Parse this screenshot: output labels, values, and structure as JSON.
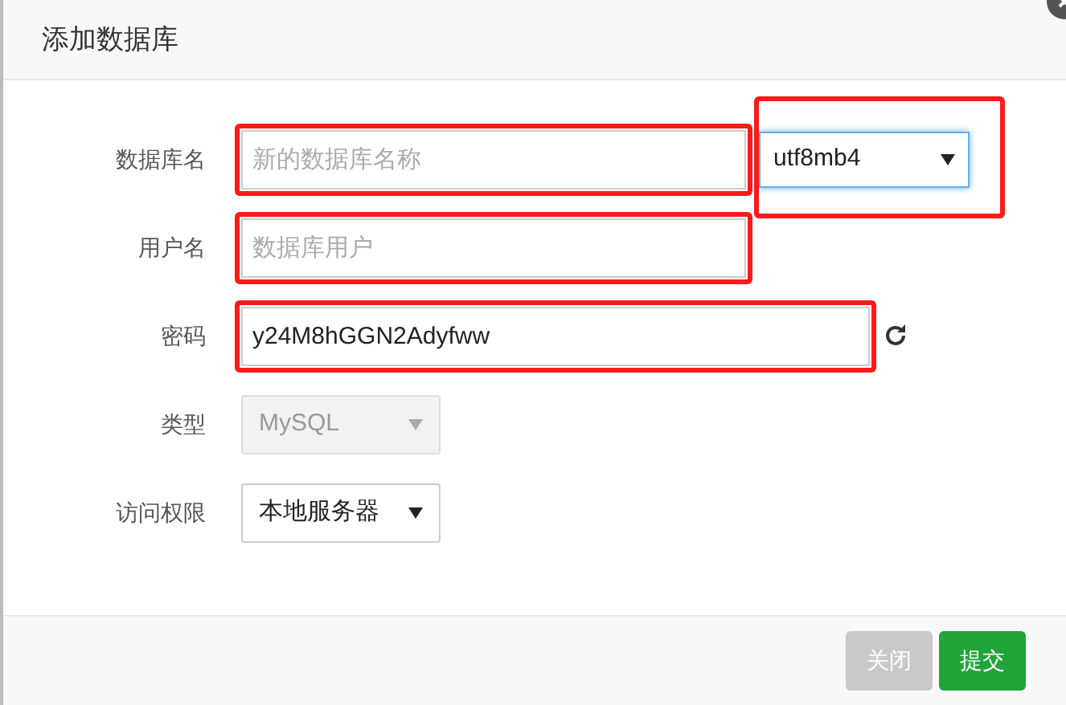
{
  "dialog": {
    "title": "添加数据库"
  },
  "fields": [
    {
      "kind": "text",
      "label": "数据库名",
      "placeholder": "新的数据库名称",
      "highlighted": true,
      "select": {
        "value": "utf8mb4",
        "highlighted": true
      }
    },
    {
      "kind": "text",
      "label": "用户名",
      "placeholder": "数据库用户",
      "highlighted": true
    },
    {
      "kind": "password",
      "label": "密码",
      "value": "y24M8hGGN2Adyfww",
      "highlighted": true
    },
    {
      "kind": "select",
      "label": "类型",
      "value": "MySQL",
      "disabled": true,
      "highlighted": false
    },
    {
      "kind": "select",
      "label": "访问权限",
      "value": "本地服务器",
      "disabled": false,
      "highlighted": false
    }
  ],
  "buttons": [
    {
      "label": "关闭",
      "kind": "secondary"
    },
    {
      "label": "提交",
      "kind": "primary"
    }
  ]
}
